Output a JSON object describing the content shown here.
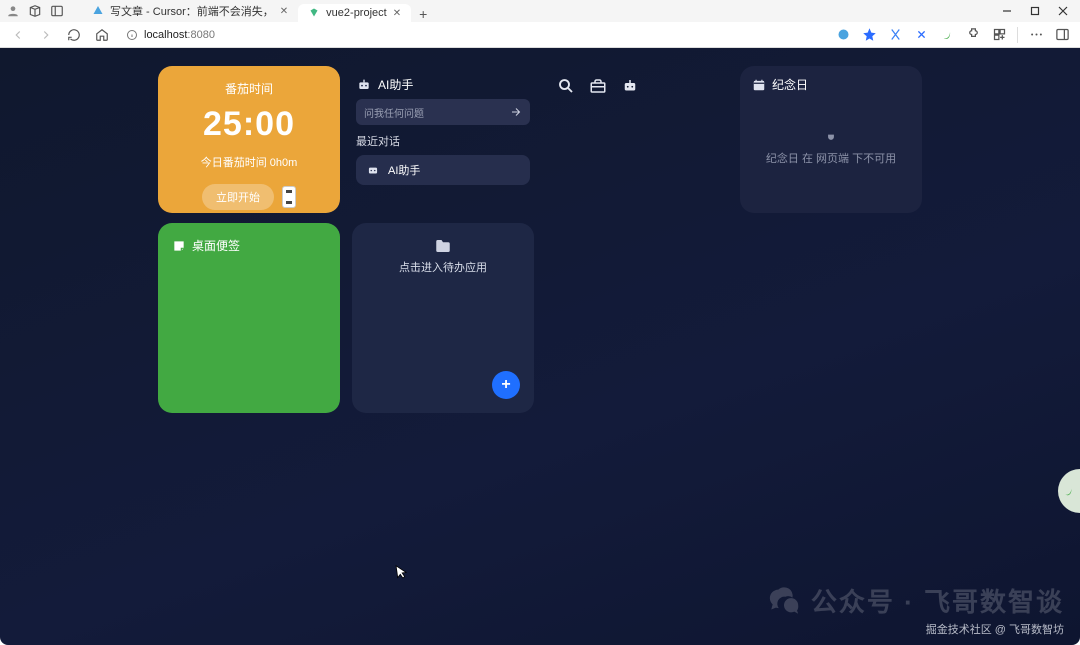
{
  "titlebar": {
    "tabs": [
      {
        "label": "写文章 - Cursor：前端不会消失，"
      },
      {
        "label": "vue2-project"
      }
    ]
  },
  "addressbar": {
    "url_host": "localhost",
    "url_port": ":8080"
  },
  "pomodoro": {
    "title": "番茄时间",
    "time": "25:00",
    "today_label": "今日番茄时间 0h0m",
    "start_label": "立即开始"
  },
  "notes": {
    "title": "桌面便签"
  },
  "ai": {
    "title": "AI助手",
    "placeholder": "问我任何问题",
    "recent_label": "最近对话",
    "recent_item": "AI助手"
  },
  "anniversary": {
    "title": "纪念日",
    "unavailable": "纪念日 在 网页端 下不可用"
  },
  "todo": {
    "hint": "点击进入待办应用"
  },
  "watermark": {
    "main": "公众号 · 飞哥数智谈",
    "sub": "掘金技术社区 @ 飞哥数智坊"
  }
}
